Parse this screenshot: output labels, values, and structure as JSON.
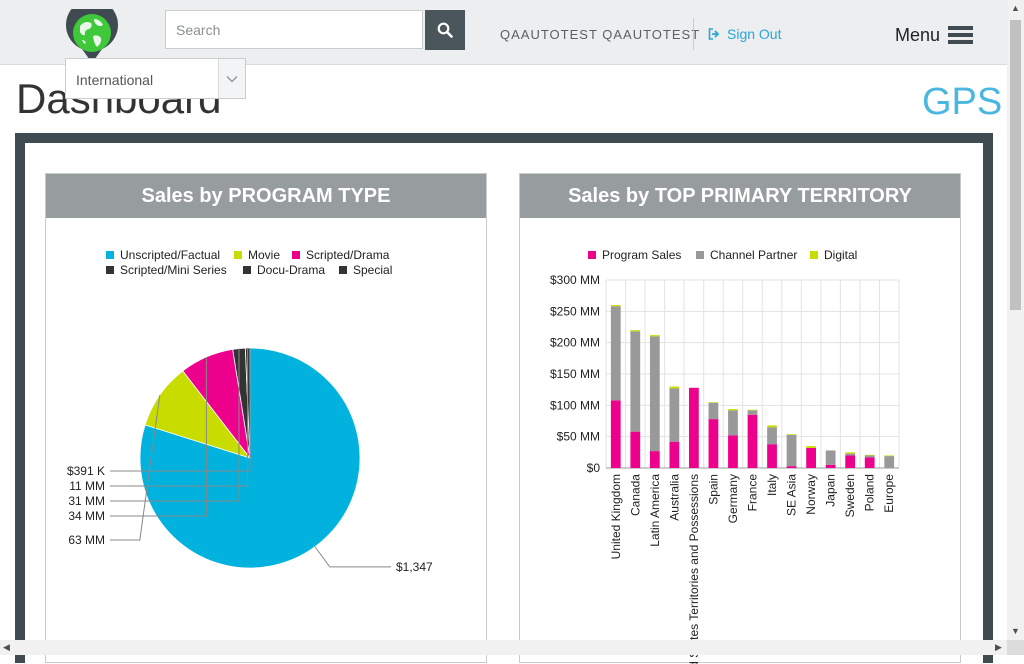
{
  "header": {
    "search_placeholder": "Search",
    "user_name": "QAAUTOTEST QAAUTOTEST",
    "sign_out_label": "Sign Out",
    "menu_label": "Menu",
    "region_selected": "International"
  },
  "page": {
    "title": "Dashboard",
    "brand": "GPS"
  },
  "colors": {
    "cyan": "#00b2dd",
    "lime": "#c8dc00",
    "magenta": "#ec008c",
    "dark": "#333333",
    "gray": "#999999",
    "accent_link": "#2aa6d9"
  },
  "panels": {
    "program_type_title": "Sales by PROGRAM TYPE",
    "territory_title": "Sales by TOP PRIMARY TERRITORY"
  },
  "chart_data": [
    {
      "type": "pie",
      "title": "Sales by PROGRAM TYPE",
      "legend_position": "top",
      "series": [
        {
          "name": "Unscripted/Factual",
          "value": 1347,
          "color": "#00b2dd",
          "label": "$1,347"
        },
        {
          "name": "Movie",
          "value": 163,
          "color": "#c8dc00",
          "label": "63 MM"
        },
        {
          "name": "Scripted/Drama",
          "value": 134,
          "color": "#ec008c",
          "label": "34 MM"
        },
        {
          "name": "Scripted/Mini Series",
          "value": 31,
          "color": "#333333",
          "label": "31 MM"
        },
        {
          "name": "Docu-Drama",
          "value": 11,
          "color": "#333333",
          "label": "11 MM"
        },
        {
          "name": "Special",
          "value": 0.391,
          "color": "#333333",
          "label": "$391 K"
        }
      ]
    },
    {
      "type": "bar",
      "stacked": true,
      "title": "Sales by TOP PRIMARY TERRITORY",
      "legend_position": "top",
      "categories": [
        "United Kingdom",
        "Canada",
        "Latin America",
        "Australia",
        "United States Territories and Possessions",
        "Spain",
        "Germany",
        "France",
        "Italy",
        "SE Asia",
        "Norway",
        "Japan",
        "Sweden",
        "Poland",
        "Europe"
      ],
      "series": [
        {
          "name": "Program Sales",
          "color": "#ec008c",
          "values": [
            108,
            58,
            27,
            42,
            128,
            78,
            52,
            85,
            38,
            3,
            32,
            5,
            20,
            17,
            0
          ]
        },
        {
          "name": "Channel Partner",
          "color": "#999999",
          "values": [
            150,
            160,
            183,
            85,
            0,
            26,
            40,
            7,
            27,
            50,
            0,
            23,
            3,
            3,
            19
          ]
        },
        {
          "name": "Digital",
          "color": "#c8dc00",
          "values": [
            2,
            2,
            2,
            3,
            0,
            1,
            2,
            1,
            3,
            1,
            3,
            0,
            2,
            1,
            1
          ]
        }
      ],
      "ylim": [
        0,
        300
      ],
      "yticks": [
        "$0",
        "$50 MM",
        "$100 MM",
        "$150 MM",
        "$200 MM",
        "$250 MM",
        "$300 MM"
      ],
      "grid": true
    }
  ]
}
